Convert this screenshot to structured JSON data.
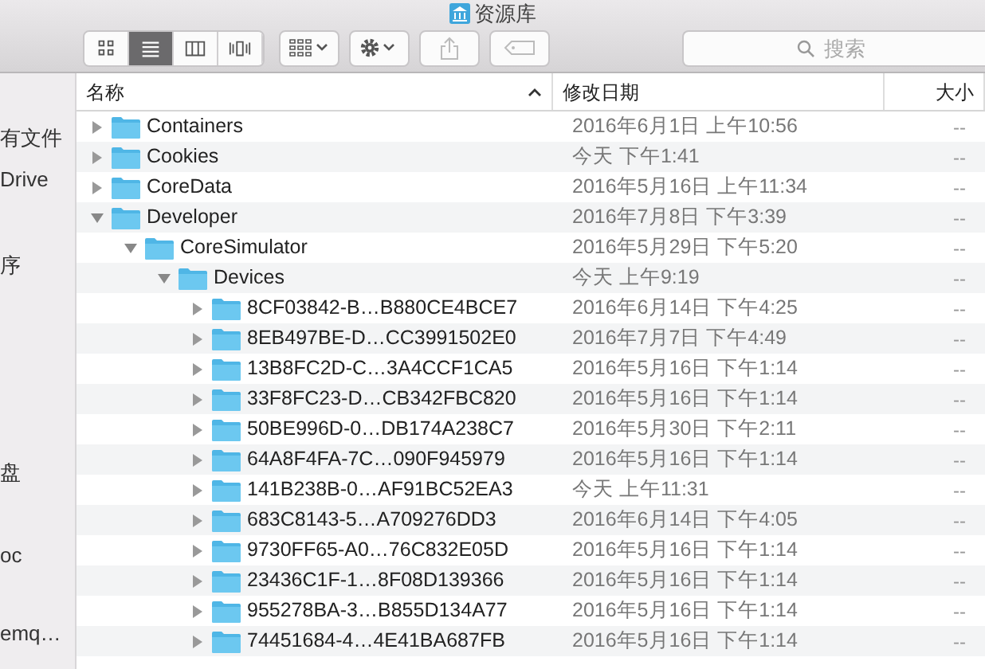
{
  "window": {
    "title": "资源库"
  },
  "toolbar": {
    "view_buttons": [
      {
        "kind": "icons",
        "selected": false
      },
      {
        "kind": "list",
        "selected": true
      },
      {
        "kind": "columns",
        "selected": false
      },
      {
        "kind": "coverflow",
        "selected": false
      }
    ],
    "search": {
      "placeholder": "搜索"
    }
  },
  "sidebar": {
    "items": [
      {
        "label": "有文件"
      },
      {
        "label": "Drive"
      },
      {
        "label": "序"
      },
      {
        "label": "盘"
      },
      {
        "label": "oc"
      },
      {
        "label": "emq…"
      }
    ]
  },
  "table": {
    "columns": [
      {
        "label": "名称",
        "sorted": true
      },
      {
        "label": "修改日期",
        "sorted": false
      },
      {
        "label": "大小",
        "sorted": false
      }
    ],
    "rows": [
      {
        "name": "Containers",
        "date": "2016年6月1日 上午10:56",
        "size": "--",
        "expanded": false
      },
      {
        "name": "Cookies",
        "date": "今天 下午1:41",
        "size": "--",
        "expanded": false
      },
      {
        "name": "CoreData",
        "date": "2016年5月16日 上午11:34",
        "size": "--",
        "expanded": false
      },
      {
        "name": "Developer",
        "date": "2016年7月8日 下午3:39",
        "size": "--",
        "expanded": true,
        "children": [
          {
            "name": "CoreSimulator",
            "date": "2016年5月29日 下午5:20",
            "size": "--",
            "expanded": true,
            "children": [
              {
                "name": "Devices",
                "date": "今天 上午9:19",
                "size": "--",
                "expanded": true,
                "children": [
                  {
                    "name": "8CF03842-B…B880CE4BCE7",
                    "date": "2016年6月14日 下午4:25",
                    "size": "--",
                    "expanded": false
                  },
                  {
                    "name": "8EB497BE-D…CC3991502E0",
                    "date": "2016年7月7日 下午4:49",
                    "size": "--",
                    "expanded": false
                  },
                  {
                    "name": "13B8FC2D-C…3A4CCF1CA5",
                    "date": "2016年5月16日 下午1:14",
                    "size": "--",
                    "expanded": false
                  },
                  {
                    "name": "33F8FC23-D…CB342FBC820",
                    "date": "2016年5月16日 下午1:14",
                    "size": "--",
                    "expanded": false
                  },
                  {
                    "name": "50BE996D-0…DB174A238C7",
                    "date": "2016年5月30日 下午2:11",
                    "size": "--",
                    "expanded": false
                  },
                  {
                    "name": "64A8F4FA-7C…090F945979",
                    "date": "2016年5月16日 下午1:14",
                    "size": "--",
                    "expanded": false
                  },
                  {
                    "name": "141B238B-0…AF91BC52EA3",
                    "date": "今天 上午11:31",
                    "size": "--",
                    "expanded": false
                  },
                  {
                    "name": "683C8143-5…A709276DD3",
                    "date": "2016年6月14日 下午4:05",
                    "size": "--",
                    "expanded": false
                  },
                  {
                    "name": "9730FF65-A0…76C832E05D",
                    "date": "2016年5月16日 下午1:14",
                    "size": "--",
                    "expanded": false
                  },
                  {
                    "name": "23436C1F-1…8F08D139366",
                    "date": "2016年5月16日 下午1:14",
                    "size": "--",
                    "expanded": false
                  },
                  {
                    "name": "955278BA-3…B855D134A77",
                    "date": "2016年5月16日 下午1:14",
                    "size": "--",
                    "expanded": false
                  },
                  {
                    "name": "74451684-4…4E41BA687FB",
                    "date": "2016年5月16日 下午1:14",
                    "size": "--",
                    "expanded": false
                  }
                ]
              }
            ]
          }
        ]
      }
    ]
  }
}
